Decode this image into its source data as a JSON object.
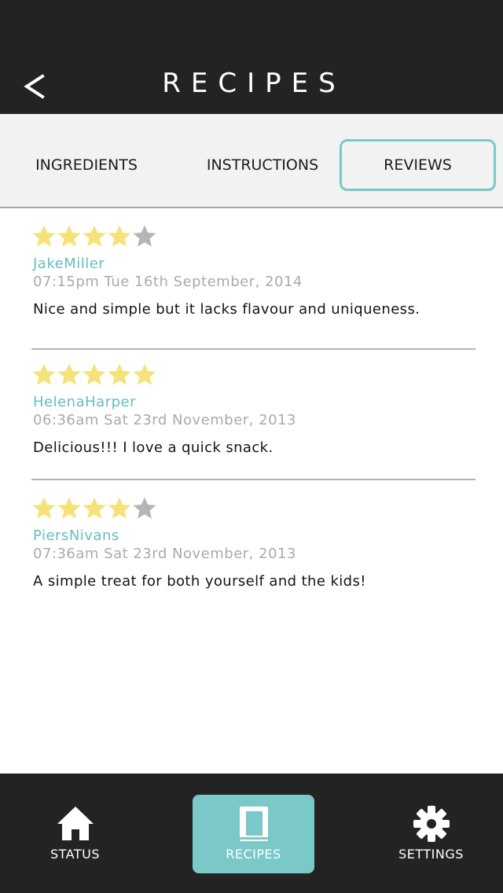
{
  "header": {
    "title": "RECIPES",
    "back_icon": "chevron-left-icon"
  },
  "tabs": [
    {
      "label": "INGREDIENTS",
      "selected": false
    },
    {
      "label": "INSTRUCTIONS",
      "selected": false
    },
    {
      "label": "REVIEWS",
      "selected": true
    }
  ],
  "reviews": [
    {
      "rating": 4,
      "max_rating": 5,
      "author": "JakeMiller",
      "date": "07:15pm Tue 16th September, 2014",
      "text": "Nice and simple but it lacks flavour and uniqueness."
    },
    {
      "rating": 5,
      "max_rating": 5,
      "author": "HelenaHarper",
      "date": "06:36am Sat 23rd November, 2013",
      "text": "Delicious!!! I love a quick snack."
    },
    {
      "rating": 4,
      "max_rating": 5,
      "author": "PiersNivans",
      "date": "07:36am Sat 23rd November, 2013",
      "text": "A simple treat for both yourself and the kids!"
    }
  ],
  "bottom_nav": [
    {
      "label": "STATUS",
      "icon": "home-icon",
      "selected": false
    },
    {
      "label": "RECIPES",
      "icon": "book-icon",
      "selected": true
    },
    {
      "label": "SETTINGS",
      "icon": "gear-icon",
      "selected": false
    }
  ],
  "colors": {
    "header_bg": "#232323",
    "accent": "#7ac8c8",
    "author": "#68bdbd",
    "star_filled": "#f6e27a",
    "star_empty": "#b5b5b5"
  }
}
